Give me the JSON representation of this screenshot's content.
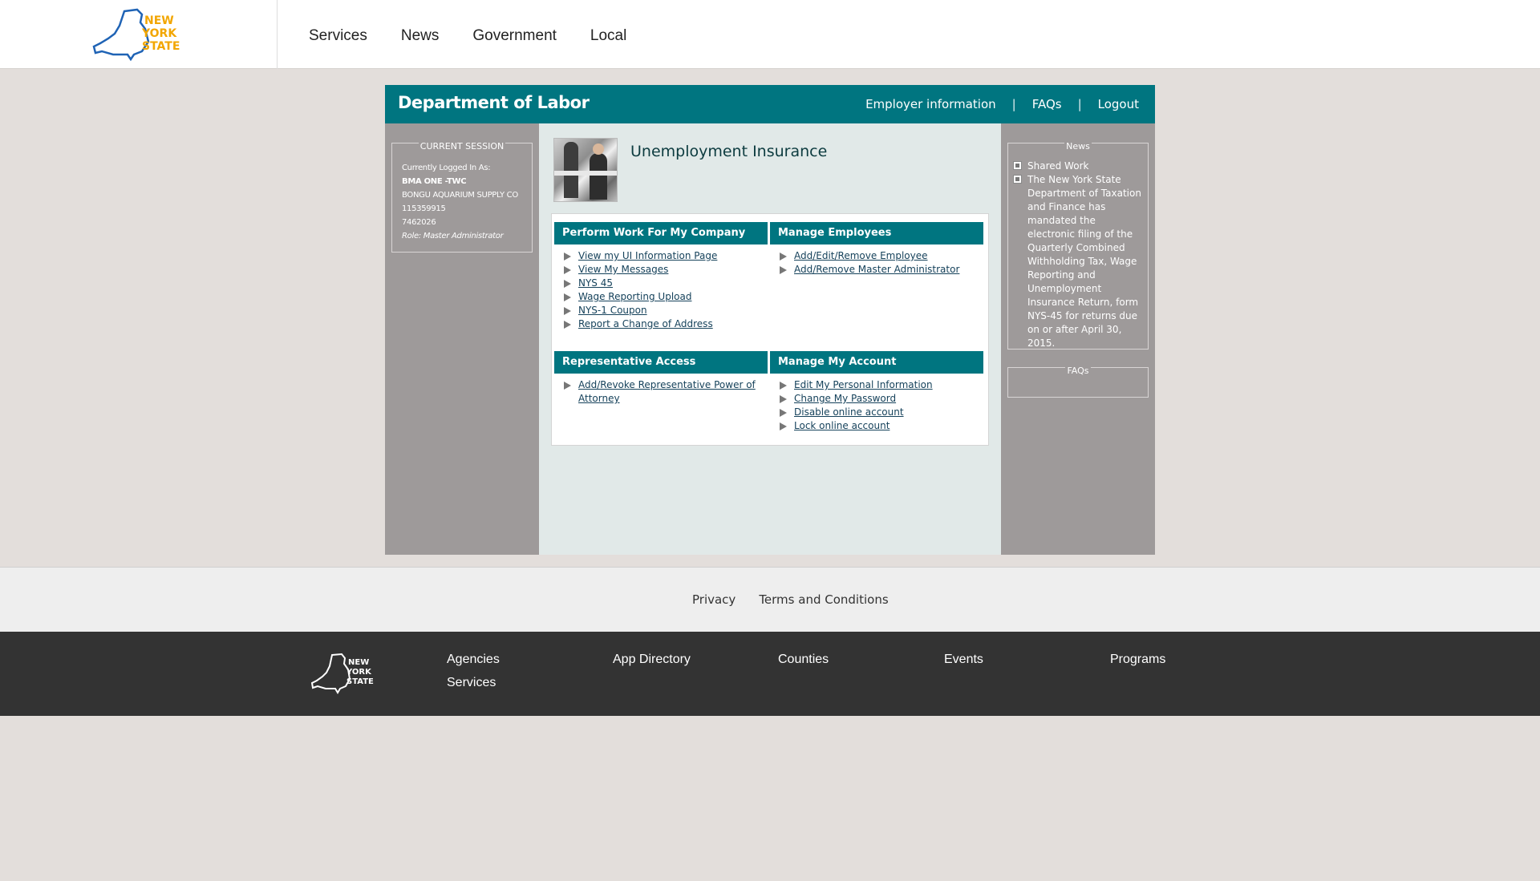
{
  "header": {
    "logo_text": [
      "NEW",
      "YORK",
      "STATE"
    ],
    "nav": [
      "Services",
      "News",
      "Government",
      "Local"
    ]
  },
  "app": {
    "title": "Department of Labor",
    "links": [
      "Employer information",
      "FAQs",
      "Logout"
    ],
    "accent_color": "#007580"
  },
  "session": {
    "legend": "CURRENT SESSION",
    "logged_in_as": "Currently Logged In As:",
    "user": "BMA ONE -TWC",
    "company": "BONGU AQUARIUM SUPPLY CO",
    "id1": "115359915",
    "id2": "7462026",
    "role": "Role: Master Administrator"
  },
  "main": {
    "title": "Unemployment Insurance",
    "boxes": [
      {
        "heading": "Perform Work For My Company",
        "items": [
          "View my UI Information Page",
          "View My Messages",
          "NYS 45",
          "Wage Reporting Upload",
          "NYS-1 Coupon",
          "Report a Change of Address"
        ]
      },
      {
        "heading": "Manage Employees",
        "items": [
          "Add/Edit/Remove Employee",
          "Add/Remove Master Administrator"
        ]
      },
      {
        "heading": "Representative Access",
        "items": [
          "Add/Revoke Representative Power of Attorney"
        ]
      },
      {
        "heading": "Manage My Account",
        "items": [
          "Edit My Personal Information",
          "Change My Password",
          "Disable online account",
          "Lock online account"
        ]
      }
    ]
  },
  "news": {
    "legend": "News",
    "items": [
      "Shared Work",
      "The New York State Department of Taxation and Finance has mandated the electronic filing of the Quarterly Combined Withholding Tax, Wage Reporting and Unemployment Insurance Return, form NYS-45 for returns due on or after April 30, 2015."
    ]
  },
  "faqs": {
    "legend": "FAQs"
  },
  "footer": {
    "links": [
      "Privacy",
      "Terms and Conditions"
    ],
    "columns": [
      "Agencies",
      "Services",
      "App Directory",
      "Counties",
      "Events",
      "Programs"
    ]
  }
}
